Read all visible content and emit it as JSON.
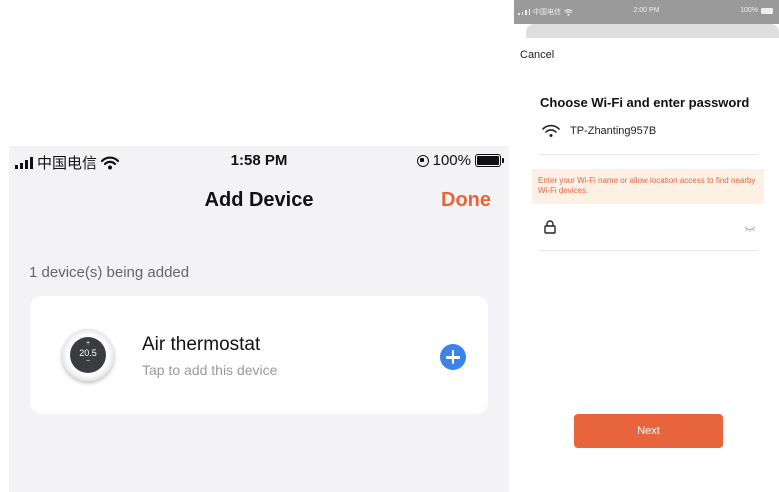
{
  "left_screen": {
    "status_bar": {
      "carrier": "中国电信",
      "time": "1:58 PM",
      "battery": "100%"
    },
    "nav": {
      "title": "Add Device",
      "done_label": "Done"
    },
    "devices_count_label": "1 device(s) being added",
    "device": {
      "name": "Air thermostat",
      "subtitle": "Tap to add this device",
      "thermostat_reading": "20.5",
      "dial_plus": "+",
      "dial_minus": "−"
    },
    "colors": {
      "accent": "#e8643d",
      "add_button": "#3d82e6",
      "background": "#f3f3f5"
    },
    "icons": [
      "signal-bars-icon",
      "wifi-icon",
      "rotation-lock-icon",
      "battery-icon",
      "plus-circle-icon",
      "thermostat-image"
    ]
  },
  "right_screen": {
    "status_bar": {
      "carrier": "中国电信",
      "time": "2:00 PM",
      "battery": "100%"
    },
    "cancel_label": "Cancel",
    "heading": "Choose Wi-Fi and enter password",
    "wifi_name": "TP-Zhanting957B",
    "warning_text": "Enter your Wi-Fi name or allow location access to find nearby Wi-Fi devices.",
    "password_value": "",
    "next_label": "Next",
    "colors": {
      "accent": "#e8643d",
      "warning_bg": "#fdf0e4"
    },
    "icons": [
      "wifi-icon",
      "lock-icon",
      "eye-closed-icon"
    ]
  }
}
